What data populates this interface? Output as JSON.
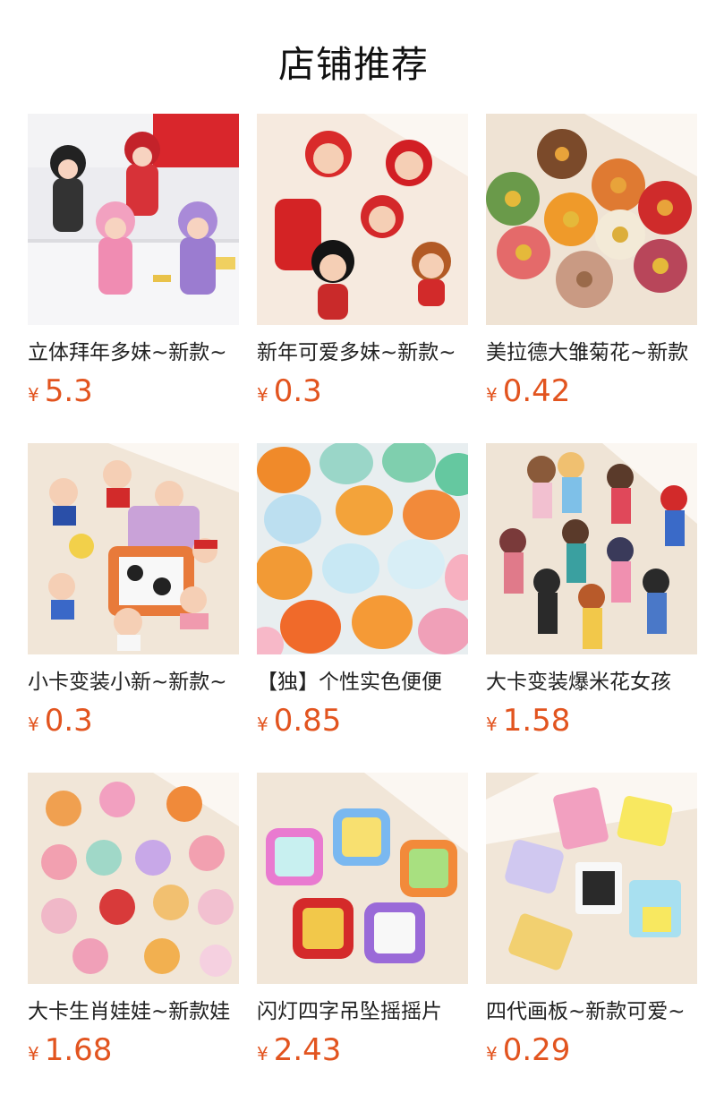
{
  "header": {
    "title": "店铺推荐"
  },
  "products": [
    {
      "name": "立体拜年多妹~新款~",
      "currency": "¥",
      "price": "5.3",
      "icon": "lion-dance-dolls-image"
    },
    {
      "name": "新年可爱多妹~新款~",
      "currency": "¥",
      "price": "0.3",
      "icon": "new-year-dolls-image"
    },
    {
      "name": "美拉德大雏菊花~新款",
      "currency": "¥",
      "price": "0.42",
      "icon": "daisy-flowers-image"
    },
    {
      "name": "小卡变装小新~新款~",
      "currency": "¥",
      "price": "0.3",
      "icon": "crayon-shin-chan-image"
    },
    {
      "name": "【独】个性实色便便",
      "currency": "¥",
      "price": "0.85",
      "icon": "poop-charms-image"
    },
    {
      "name": "大卡变装爆米花女孩",
      "currency": "¥",
      "price": "1.58",
      "icon": "popcorn-girls-image"
    },
    {
      "name": "大卡生肖娃娃~新款娃",
      "currency": "¥",
      "price": "1.68",
      "icon": "zodiac-dolls-image"
    },
    {
      "name": "闪灯四字吊坠摇摇片",
      "currency": "¥",
      "price": "2.43",
      "icon": "four-character-pendant-image"
    },
    {
      "name": "四代画板~新款可爱~",
      "currency": "¥",
      "price": "0.29",
      "icon": "drawing-board-image"
    }
  ],
  "colors": {
    "price": "#e2541f",
    "title": "#111111"
  }
}
